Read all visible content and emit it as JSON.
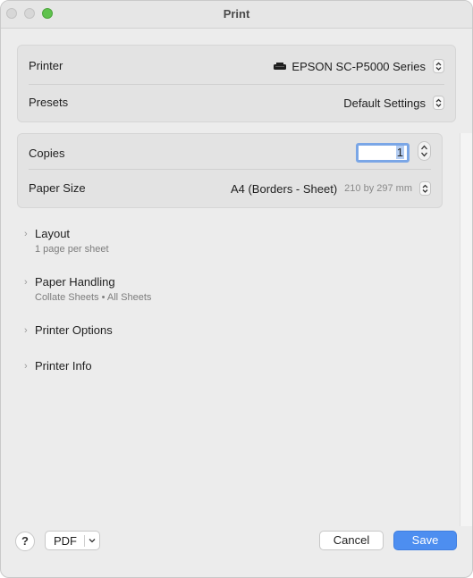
{
  "window": {
    "title": "Print"
  },
  "printer_panel": {
    "printer_label": "Printer",
    "printer_value": "EPSON SC-P5000 Series",
    "presets_label": "Presets",
    "presets_value": "Default Settings"
  },
  "copies_panel": {
    "copies_label": "Copies",
    "copies_value": "1",
    "paper_size_label": "Paper Size",
    "paper_size_value": "A4 (Borders - Sheet)",
    "paper_size_dims": "210 by 297 mm"
  },
  "sections": [
    {
      "name": "Layout",
      "sub": "1 page per sheet"
    },
    {
      "name": "Paper Handling",
      "sub": "Collate Sheets • All Sheets"
    },
    {
      "name": "Printer Options",
      "sub": ""
    },
    {
      "name": "Printer Info",
      "sub": ""
    }
  ],
  "footer": {
    "help_label": "?",
    "pdf_label": "PDF",
    "cancel_label": "Cancel",
    "save_label": "Save"
  },
  "colors": {
    "accent": "#4d8ef0",
    "window_bg": "#ececec",
    "zoom_button": "#5fc24d"
  },
  "icons": {
    "printer": "printer-icon",
    "chevron": "chevron-right-icon",
    "updown": "updown-chevron-icon"
  }
}
